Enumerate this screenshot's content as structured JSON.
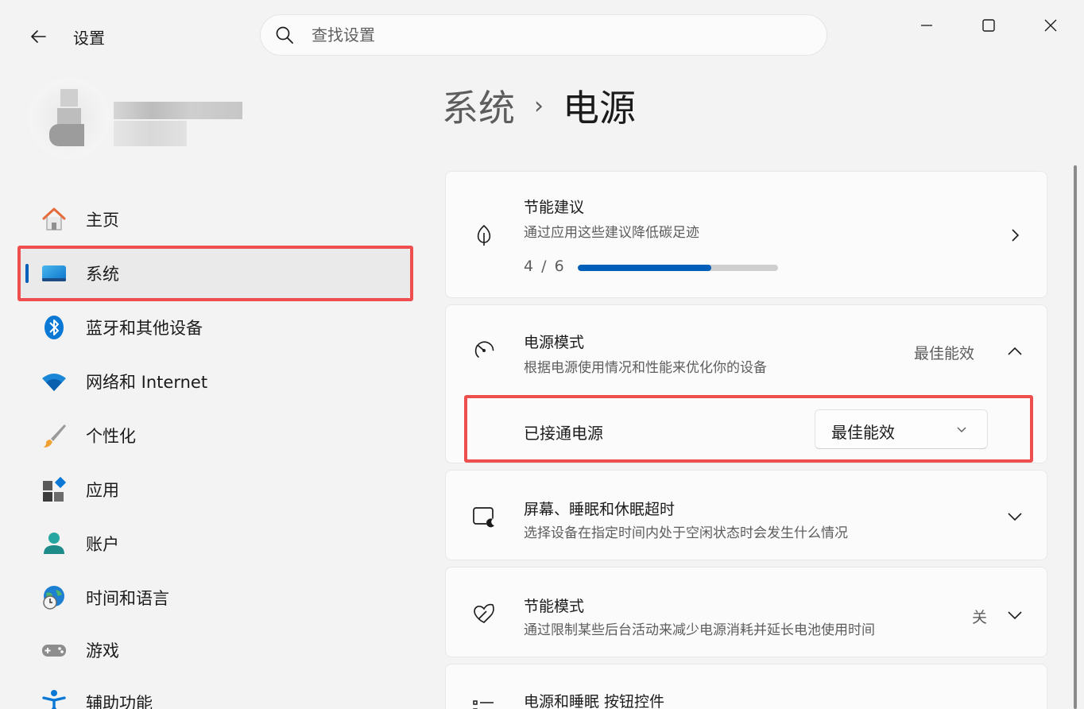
{
  "titlebar": {
    "app_title": "设置",
    "search_placeholder": "查找设置"
  },
  "sidebar": {
    "items": [
      {
        "label": "主页",
        "icon": "home-icon"
      },
      {
        "label": "系统",
        "icon": "monitor-icon",
        "active": true
      },
      {
        "label": "蓝牙和其他设备",
        "icon": "bluetooth-icon"
      },
      {
        "label": "网络和 Internet",
        "icon": "wifi-icon"
      },
      {
        "label": "个性化",
        "icon": "brush-icon"
      },
      {
        "label": "应用",
        "icon": "apps-icon"
      },
      {
        "label": "账户",
        "icon": "account-icon"
      },
      {
        "label": "时间和语言",
        "icon": "globe-clock-icon"
      },
      {
        "label": "游戏",
        "icon": "gamepad-icon"
      },
      {
        "label": "辅助功能",
        "icon": "accessibility-icon"
      }
    ]
  },
  "breadcrumb": {
    "parent": "系统",
    "separator": "›",
    "current": "电源"
  },
  "cards": {
    "energy_recommendations": {
      "title": "节能建议",
      "subtitle": "通过应用这些建议降低碳足迹",
      "progress_text": "4 / 6",
      "progress_fraction": 0.667
    },
    "power_mode": {
      "title": "电源模式",
      "subtitle": "根据电源使用情况和性能来优化你的设备",
      "value": "最佳能效",
      "plugged_in_label": "已接通电源",
      "plugged_in_value": "最佳能效"
    },
    "screen_sleep": {
      "title": "屏幕、睡眠和休眠超时",
      "subtitle": "选择设备在指定时间内处于空闲状态时会发生什么情况"
    },
    "energy_saver": {
      "title": "节能模式",
      "subtitle": "通过限制某些后台活动来减少电源消耗并延长电池使用时间",
      "value": "关"
    },
    "power_button": {
      "title": "电源和睡眠 按钮控件"
    }
  },
  "colors": {
    "accent": "#005fb8",
    "highlight": "#ef4e4e"
  }
}
